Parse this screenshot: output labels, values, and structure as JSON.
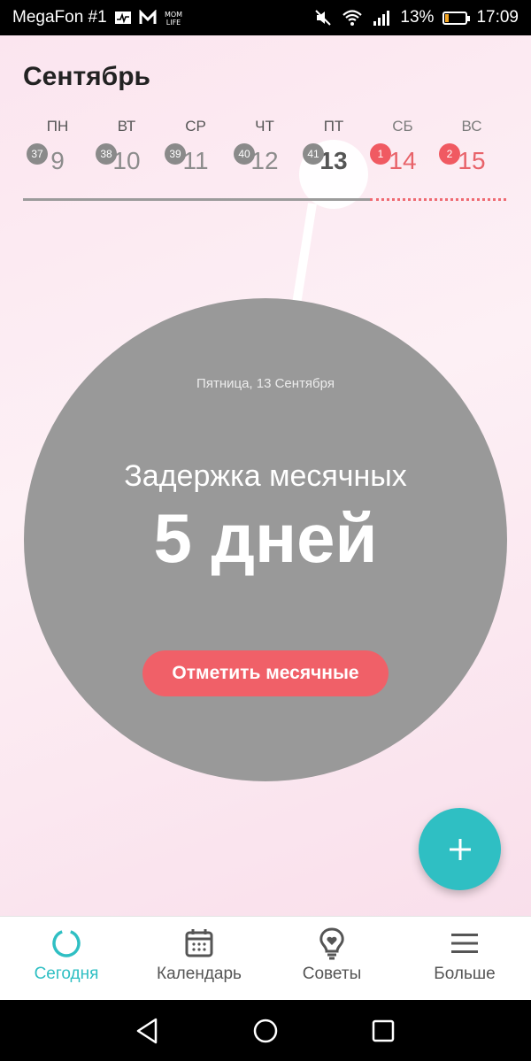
{
  "status_bar": {
    "carrier": "MegaFon #1",
    "battery_percent": "13%",
    "time": "17:09",
    "icons": [
      "activity-icon",
      "gmail-icon",
      "momlife-icon",
      "mute-icon",
      "wifi-icon",
      "signal-icon",
      "battery-icon"
    ]
  },
  "header": {
    "month": "Сентябрь"
  },
  "week": [
    {
      "name": "ПН",
      "number": "9",
      "badge": "37",
      "type": "normal"
    },
    {
      "name": "ВТ",
      "number": "10",
      "badge": "38",
      "type": "normal"
    },
    {
      "name": "СР",
      "number": "11",
      "badge": "39",
      "type": "normal"
    },
    {
      "name": "ЧТ",
      "number": "12",
      "badge": "40",
      "type": "normal"
    },
    {
      "name": "ПТ",
      "number": "13",
      "badge": "41",
      "type": "today"
    },
    {
      "name": "СБ",
      "number": "14",
      "badge": "1",
      "type": "period"
    },
    {
      "name": "ВС",
      "number": "15",
      "badge": "2",
      "type": "period"
    }
  ],
  "circle": {
    "date": "Пятница, 13 Сентября",
    "label": "Задержка месячных",
    "value": "5 дней",
    "button": "Отметить месячные"
  },
  "fab": {
    "icon": "plus-icon"
  },
  "bottom_nav": [
    {
      "label": "Сегодня",
      "icon": "today-ring-icon",
      "active": true
    },
    {
      "label": "Календарь",
      "icon": "calendar-icon",
      "active": false
    },
    {
      "label": "Советы",
      "icon": "bulb-heart-icon",
      "active": false
    },
    {
      "label": "Больше",
      "icon": "menu-icon",
      "active": false
    }
  ],
  "colors": {
    "accent_teal": "#2fbfc3",
    "period_red": "#f05a62",
    "circle_gray": "#999999",
    "background_pink": "#fbe7f0"
  }
}
